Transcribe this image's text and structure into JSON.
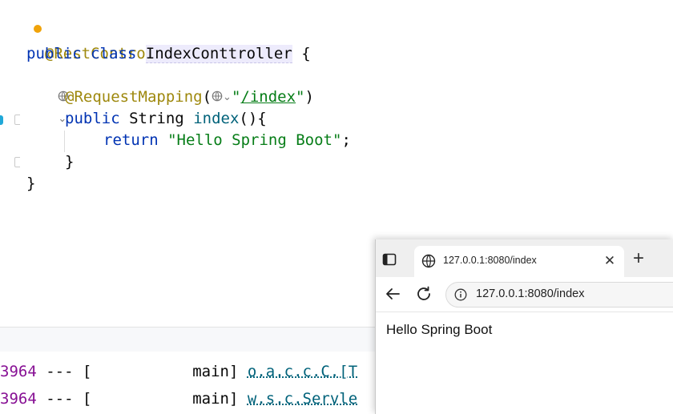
{
  "editor": {
    "lines": {
      "l1": {
        "annotation": "@RestController"
      },
      "l2": {
        "kw1": "public",
        "kw2": "class",
        "class_name": "IndexConttroller",
        "brace": "{"
      },
      "l4": {
        "annotation": "@RequestMapping",
        "open": "(",
        "q1": "\"",
        "url": "/index",
        "q2": "\"",
        "close": ")"
      },
      "l5": {
        "kw1": "public",
        "type": "String",
        "method": "index",
        "paren": "(){"
      },
      "l6": {
        "kw": "return",
        "string": "\"Hello Spring Boot\"",
        "semi": ";"
      },
      "l7": {
        "brace": "}"
      },
      "l8": {
        "brace": "}"
      }
    },
    "inlay_chevron": "⌄"
  },
  "console": {
    "rows": [
      {
        "pid": "3964",
        "mid": " --- [",
        "thread": "           main]",
        "logger": "o.a.c.c.C.[T"
      },
      {
        "pid": "3964",
        "mid": " --- [",
        "thread": "           main]",
        "logger": "w.s.c.Servle"
      }
    ]
  },
  "browser": {
    "tab_title": "127.0.0.1:8080/index",
    "close_glyph": "✕",
    "newtab_glyph": "+",
    "address": "127.0.0.1:8080/index",
    "page_text": "Hello Spring Boot"
  },
  "icons": {
    "sidebar_toggle": "tab-actions-icon",
    "globe": "globe-icon",
    "back": "back-arrow-icon",
    "reload": "reload-icon",
    "info": "info-icon"
  },
  "colors": {
    "keyword": "#0033b3",
    "annotation": "#9e880d",
    "string": "#067d17",
    "method": "#00627a",
    "pid": "#871094"
  }
}
